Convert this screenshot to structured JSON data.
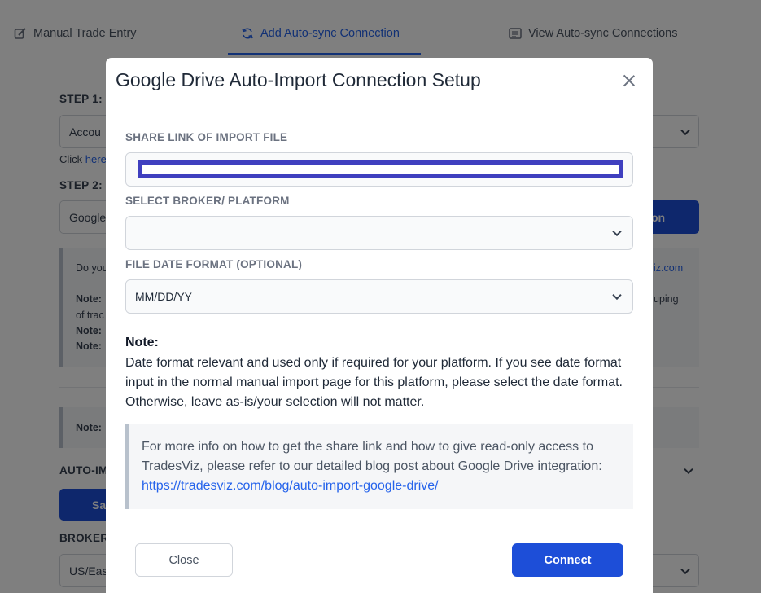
{
  "tabs": [
    {
      "label": "Manual Trade Entry",
      "icon": "edit-icon"
    },
    {
      "label": "Add Auto-sync Connection",
      "icon": "sync-icon",
      "active": true
    },
    {
      "label": "View Auto-sync Connections",
      "icon": "list-icon"
    }
  ],
  "background": {
    "step1_label": "STEP 1: T",
    "account_field": "Accou",
    "click_here_prefix": "Click ",
    "click_here_link": "here",
    "step2_label": "STEP 2:",
    "google_field": "Google",
    "add_button_partial": "on",
    "note_do_you": "Do you",
    "note_link_partial": "iz.com",
    "note_label": "Note:",
    "note_grouping": "uping",
    "note_of_trad": "of trac",
    "note_label_2": "Note:",
    "note_label_3": "Note:",
    "note_label_4": "Note:",
    "auto_import_label": "AUTO-IM",
    "save_button_partial": "Sa",
    "broker_label": "BROKER",
    "timezone_field": "US/Eas"
  },
  "modal": {
    "title": "Google Drive Auto-Import Connection Setup",
    "share_link_label": "SHARE LINK OF IMPORT FILE",
    "share_link_value": "",
    "broker_label": "SELECT BROKER/ PLATFORM",
    "broker_value": "",
    "date_format_label": "FILE DATE FORMAT (OPTIONAL)",
    "date_format_value": "MM/DD/YY",
    "note_heading": "Note:",
    "note_text": "Date format relevant and used only if required for your platform. If you see date format input in the normal manual import page for this platform, please select the date format. Otherwise, leave as-is/your selection will not matter.",
    "info_text": "For more info on how to get the share link and how to give read-only access to TradesViz, please refer to our detailed blog post about Google Drive integration: ",
    "info_link": "https://tradesviz.com/blog/auto-import-google-drive/",
    "close_button": "Close",
    "connect_button": "Connect"
  },
  "colors": {
    "accent": "#1d4ed8",
    "link": "#2563eb",
    "overlay": "rgba(0,0,0,0.5)"
  }
}
